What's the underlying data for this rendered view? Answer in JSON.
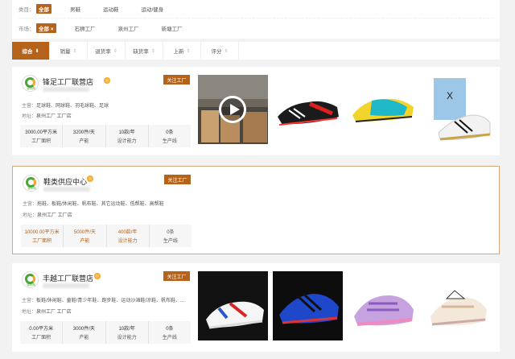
{
  "filters": {
    "category": {
      "label": "类目：",
      "options": [
        "全部",
        "男鞋",
        "运动鞋",
        "运动/健身"
      ]
    },
    "market": {
      "label": "市场：",
      "selected": "全部 ×",
      "options": [
        "石狮工厂",
        "泉州工厂",
        "新塘工厂"
      ]
    }
  },
  "sort_tabs": [
    {
      "label": "综合",
      "arrow": "⬇"
    },
    {
      "label": "销量",
      "arrow": "⇕"
    },
    {
      "label": "退货率",
      "arrow": "⇕"
    },
    {
      "label": "缺货率",
      "arrow": "⇕"
    },
    {
      "label": "上新",
      "arrow": "⇕"
    },
    {
      "label": "评分",
      "arrow": "⇕"
    }
  ],
  "follow_label": "关注工厂",
  "logo_text": "源印网",
  "shops": [
    {
      "name": "锋足工厂联营店",
      "main_label": "主营：",
      "main": "足球鞋、网球鞋、羽毛球鞋、足球",
      "addr_label": "地址：",
      "addr": "泉州工厂 工厂店",
      "stats": [
        {
          "value": "3000.00平方米",
          "label": "工厂面积"
        },
        {
          "value": "3200件/天",
          "label": "产能"
        },
        {
          "value": "10款/年",
          "label": "设计能力"
        },
        {
          "value": "0条",
          "label": "生产线"
        }
      ]
    },
    {
      "name": "鞋类供应中心",
      "main_label": "主营：",
      "main": "拖鞋、板鞋/休闲鞋、帆布鞋、其它运动鞋、低帮鞋、高帮鞋",
      "addr_label": "地址：",
      "addr": "泉州工厂 工厂店",
      "stats": [
        {
          "value": "10000.00平方米",
          "label": "工厂面积"
        },
        {
          "value": "5000件/天",
          "label": "产能"
        },
        {
          "value": "400款/年",
          "label": "设计能力"
        },
        {
          "value": "0条",
          "label": "生产线"
        }
      ]
    },
    {
      "name": "丰越工厂联营店",
      "main_label": "主营：",
      "main": "板鞋/休闲鞋、童鞋/青少年鞋、跑步鞋、运动沙滩鞋/凉鞋、帆布鞋、...",
      "addr_label": "地址：",
      "addr": "泉州工厂 工厂店",
      "stats": [
        {
          "value": "0.00平方米",
          "label": "工厂面积"
        },
        {
          "value": "3000件/天",
          "label": "产能"
        },
        {
          "value": "10款/年",
          "label": "设计能力"
        },
        {
          "value": "0条",
          "label": "生产线"
        }
      ]
    }
  ],
  "colors": {
    "accent": "#b5621a",
    "highlight_border": "#d9a77a"
  }
}
